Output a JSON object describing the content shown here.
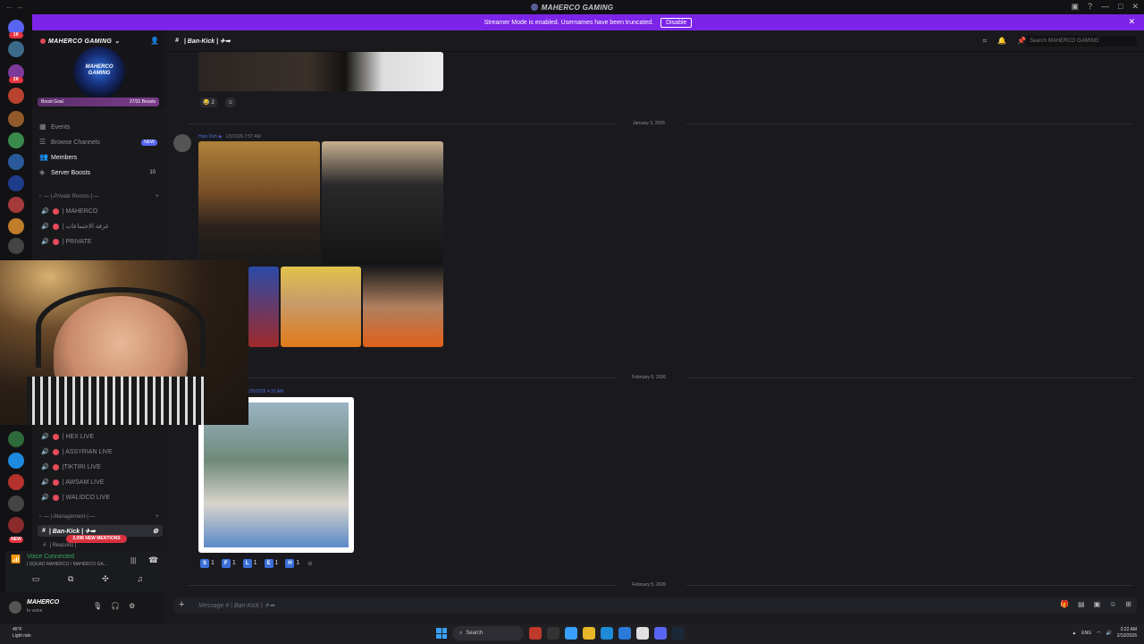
{
  "window": {
    "title": "MAHERCO GAMING",
    "controls": [
      "—",
      "□",
      "✕"
    ]
  },
  "banner": {
    "text": "Streamer Mode is enabled. Usernames have been truncated.",
    "button": "Disable"
  },
  "server": {
    "name": "MAHERCO GAMING",
    "banner_text": "MAHERCO GAMING",
    "boost_label": "Boost Goal",
    "boost_value": "27/31 Boosts",
    "boost_progress": 0.87
  },
  "nav": {
    "events": "Events",
    "browse": "Browse Channels",
    "browse_badge": "NEW",
    "members": "Members",
    "boosts": "Server Boosts",
    "boosts_count": "10"
  },
  "categories": {
    "private": "— |-Private Rooms-| —",
    "management": "— |-Management-| —"
  },
  "private_rooms": [
    "| MAHERCO",
    "| غرفة الاجتماعات",
    "| PRIVATE"
  ],
  "live_rooms": [
    "| HEX LIVE",
    "| ASSYRIAN LIVE",
    "|TIKTIRI LIVE",
    "| AWSAM LIVE",
    "| WALIDCO LIVE"
  ],
  "text_channel": {
    "name": "| Ban-Kick | ✈➡",
    "below": "| Reasons |",
    "mentions": "2,098 NEW MENTIONS"
  },
  "voice": {
    "status": "Voice Connected",
    "channel": "| SQUAD MAHERCO / MAHERCO GA..."
  },
  "user": {
    "name": "MAHERCO",
    "status": "In voice"
  },
  "header": {
    "channel": "| Ban-Kick | ✈➡",
    "search_placeholder": "Search MAHERCO GAMING"
  },
  "messages": {
    "reaction1_count": "2",
    "date1": "January 3, 2026",
    "author1": "Hani Deh",
    "time1": "1/3/2026 7:57 AM",
    "date2": "February 5, 2026",
    "time2": "2/5/2026 4:33 AM",
    "date3": "February 5, 2026",
    "tags": [
      {
        "letter": "S",
        "count": "1",
        "color": "#3b6fd8"
      },
      {
        "letter": "F",
        "count": "1",
        "color": "#3b6fd8"
      },
      {
        "letter": "L",
        "count": "1",
        "color": "#3b6fd8"
      },
      {
        "letter": "E",
        "count": "1",
        "color": "#3b6fd8"
      },
      {
        "letter": "H",
        "count": "1",
        "color": "#3b6fd8"
      }
    ]
  },
  "composer": {
    "placeholder": "Message # | Ban-Kick | ✈➡"
  },
  "taskbar": {
    "temp": "45°F",
    "weather": "Light rain",
    "search": "Search",
    "lang": "ENG",
    "time": "3:22 AM",
    "date": "2/10/2026"
  },
  "colors": {
    "accent": "#5865f2",
    "banner": "#7c24e8",
    "voice_green": "#3ba55d",
    "mention_red": "#d9313f"
  }
}
